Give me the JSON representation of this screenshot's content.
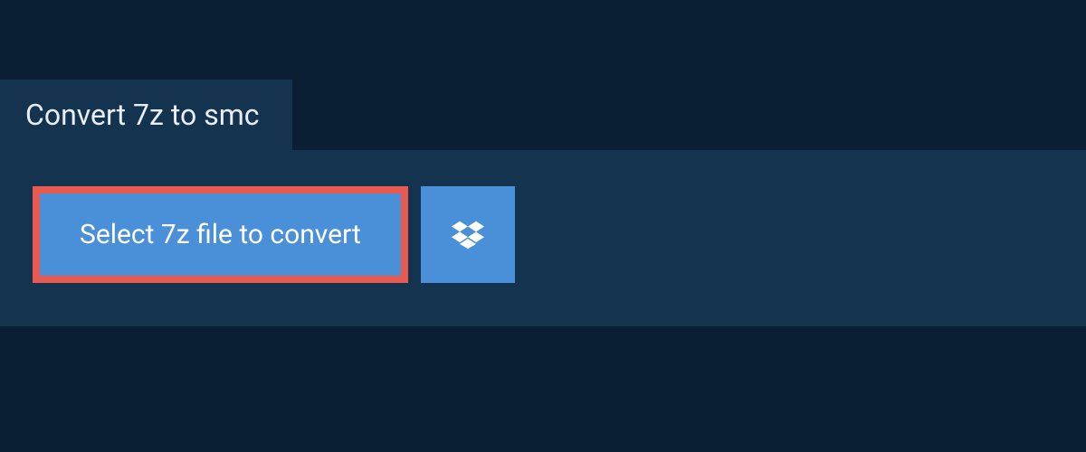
{
  "tab": {
    "title": "Convert 7z to smc"
  },
  "actions": {
    "select_label": "Select 7z file to convert"
  }
}
